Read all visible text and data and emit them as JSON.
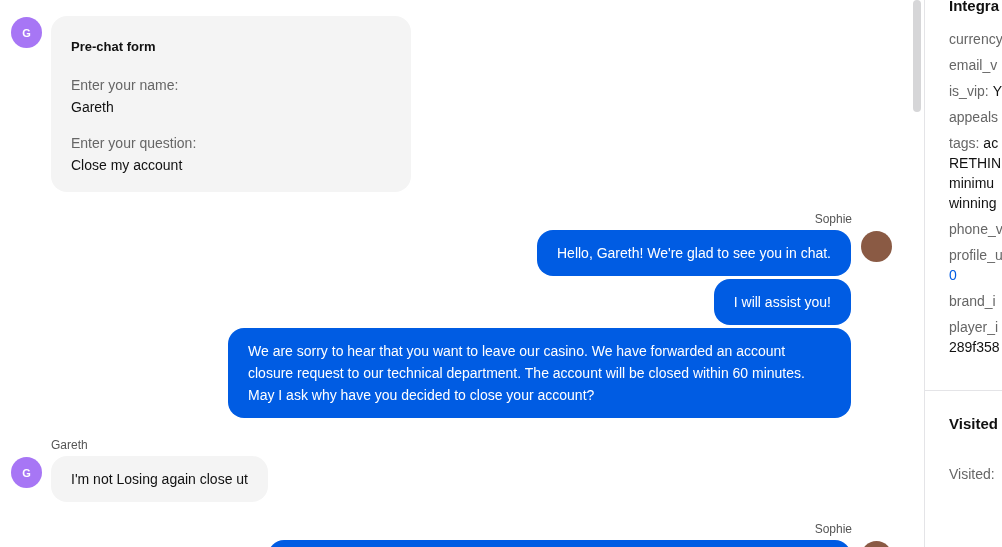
{
  "chat": {
    "messages": [
      {
        "kind": "form",
        "from_agent": false,
        "avatar": "G",
        "title": "Pre-chat form",
        "fields": [
          {
            "label": "Enter your name:",
            "value": "Gareth"
          },
          {
            "label": "Enter your question:",
            "value": "Close my account"
          }
        ]
      },
      {
        "kind": "text",
        "from_agent": true,
        "sender": "Sophie",
        "text": "Hello, Gareth! We're glad to see you in chat."
      },
      {
        "kind": "text",
        "from_agent": true,
        "text": "I will assist you!"
      },
      {
        "kind": "text",
        "from_agent": true,
        "text": "We are sorry to hear that you want to leave our casino. We have forwarded an account closure request to our technical department. The account will be closed within 60 minutes. May I ask why have you decided to close your account?"
      },
      {
        "kind": "text",
        "from_agent": false,
        "sender": "Gareth",
        "avatar": "G",
        "text": "I'm not Losing again close ut"
      },
      {
        "kind": "partial",
        "from_agent": true,
        "sender": "Sophie"
      }
    ]
  },
  "panel": {
    "sections": [
      {
        "title": "Integra",
        "fields": [
          {
            "label": "currency"
          },
          {
            "label": "email_v"
          },
          {
            "label": "is_vip:",
            "value": "Y"
          },
          {
            "label": "appeals"
          },
          {
            "label": "tags:",
            "value": "ac",
            "continuation": [
              "RETHIN",
              "minimu",
              "winning"
            ]
          },
          {
            "label": "phone_v"
          },
          {
            "label": "profile_u",
            "continuation": [
              "0"
            ],
            "link": true
          },
          {
            "label": "brand_i"
          },
          {
            "label": "player_i",
            "continuation": [
              "289f358"
            ]
          }
        ]
      },
      {
        "title": "Visited",
        "fields": [
          {
            "label": "Visited:"
          }
        ]
      }
    ]
  }
}
